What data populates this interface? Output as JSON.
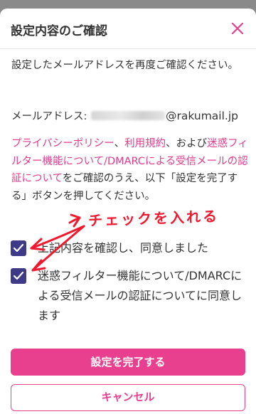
{
  "dialog": {
    "title": "設定内容のご確認",
    "close_icon": "close-icon",
    "instruction": "設定したメールアドレスを再度ご確認ください。",
    "email_label": "メールアドレス:",
    "email_domain": "@rakumail.jp",
    "agreement": {
      "link_privacy": "プライバシーポリシー",
      "sep1": "、",
      "link_terms": "利用規約",
      "text_and": "、および",
      "link_spam": "迷惑フィルター機能について/DMARCによる受信メールの認証について",
      "text_after": "をご確認のうえ、以下「設定を完了する」ボタンを押してください。"
    },
    "checkboxes": [
      {
        "label": "上記内容を確認し、同意しました",
        "checked": true
      },
      {
        "label": "迷惑フィルター機能について/DMARCによる受信メールの認証についてに同意します",
        "checked": true
      }
    ],
    "primary_button": "設定を完了する",
    "cancel_button": "キャンセル"
  },
  "annotation": {
    "text": "チェックを入れる",
    "color": "#f0192f"
  },
  "colors": {
    "accent": "#e8408f",
    "link": "#e23b8c",
    "checkbox": "#3f3a88"
  }
}
